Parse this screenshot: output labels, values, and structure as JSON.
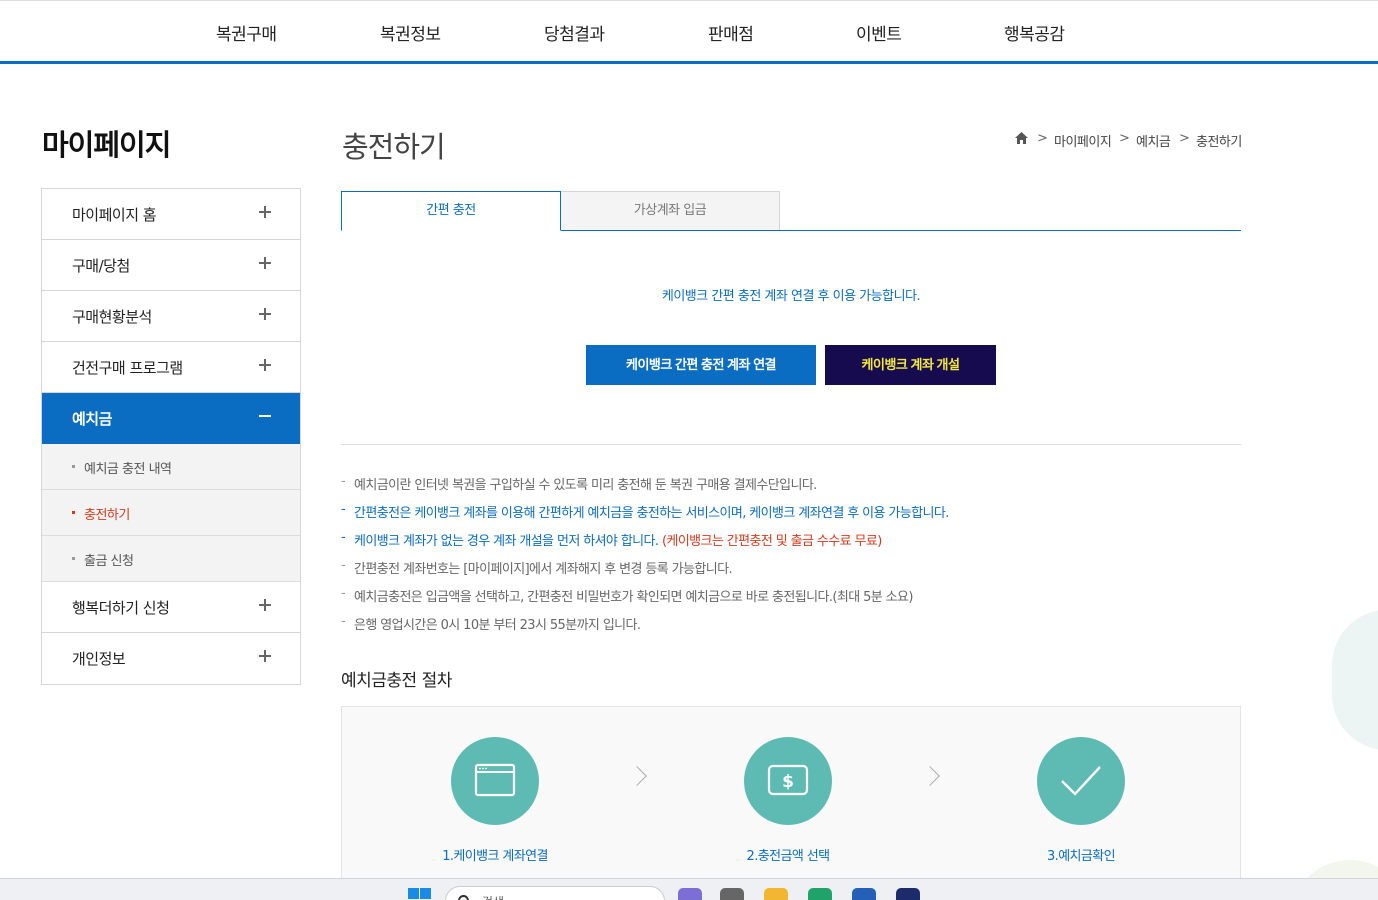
{
  "top_nav": [
    "복권구매",
    "복권정보",
    "당첨결과",
    "판매점",
    "이벤트",
    "행복공감"
  ],
  "sidebar": {
    "title": "마이페이지",
    "menu": [
      {
        "label": "마이페이지 홈"
      },
      {
        "label": "구매/당첨"
      },
      {
        "label": "구매현황분석"
      },
      {
        "label": "건전구매 프로그램"
      },
      {
        "label": "예치금",
        "active": true,
        "sub": [
          {
            "label": "예치금 충전 내역"
          },
          {
            "label": "충전하기",
            "current": true
          },
          {
            "label": "출금 신청"
          }
        ]
      },
      {
        "label": "행복더하기 신청"
      },
      {
        "label": "개인정보"
      }
    ]
  },
  "page": {
    "title": "충전하기",
    "breadcrumb": [
      "마이페이지",
      "예치금",
      "충전하기"
    ]
  },
  "tabs": [
    {
      "label": "간편 충전",
      "active": true
    },
    {
      "label": "가상계좌 입금",
      "active": false
    }
  ],
  "notice": "케이뱅크 간편 충전 계좌 연결 후 이용 가능합니다.",
  "buttons": {
    "link_account": "케이뱅크 간편 충전 계좌 연결",
    "open_account": "케이뱅크 계좌 개설"
  },
  "info_list": [
    "예치금이란 인터넷 복권을 구입하실 수 있도록 미리 충전해 둔 복권 구매용 결제수단입니다.",
    "간편충전은 케이뱅크 계좌를 이용해 간편하게 예치금을 충전하는 서비스이며, 케이뱅크 계좌연결 후 이용 가능합니다.",
    "케이뱅크 계좌가 없는 경우 계좌 개설을 먼저 하셔야 합니다.",
    "(케이뱅크는 간편충전 및 출금 수수료 무료)",
    "간편충전 계좌번호는 [마이페이지]에서 계좌해지 후 변경 등록 가능합니다.",
    "예치금충전은 입금액을 선택하고, 간편충전 비밀번호가 확인되면 예치금으로 바로 충전됩니다.(최대 5분 소요)",
    "은행 영업시간은 0시 10분 부터 23시 55분까지 입니다."
  ],
  "procedure": {
    "title": "예치금충전 절차",
    "steps": [
      "1.케이뱅크 계좌연결",
      "2.충전금액 선택",
      "3.예치금확인"
    ]
  },
  "taskbar": {
    "search_placeholder": "검색"
  },
  "colors": {
    "primary": "#0a6dc2",
    "navy": "#160b4f",
    "teal": "#5dbbb3",
    "red": "#d63a1c"
  }
}
